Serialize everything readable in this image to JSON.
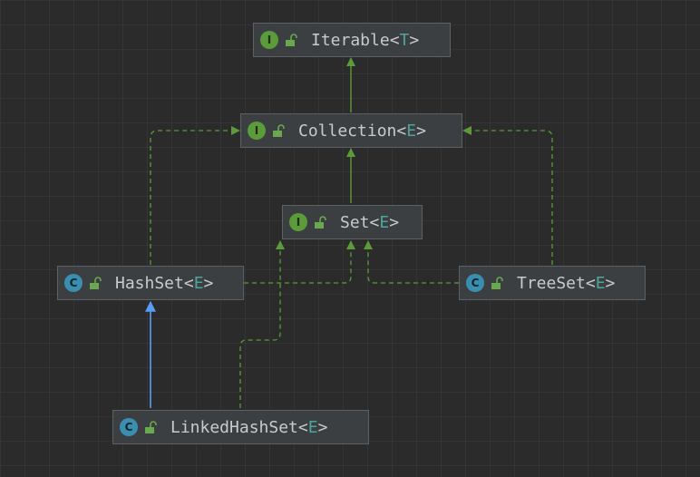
{
  "colors": {
    "background": "#2b2b2b",
    "node_fill": "#3c3f41",
    "node_border": "#5e6164",
    "text": "#c8cbce",
    "type_param": "#4fa59a",
    "implements_edge": "#5c9b3a",
    "extends_edge": "#589df6",
    "interface_badge": "#5c9b3a",
    "class_badge": "#3a8fb0"
  },
  "nodes": {
    "iterable": {
      "kind": "interface",
      "badge": "I",
      "name": "Iterable",
      "open": "<",
      "type_param": "T",
      "close": ">",
      "icon": "unlocked-padlock-icon"
    },
    "collection": {
      "kind": "interface",
      "badge": "I",
      "name": "Collection",
      "open": "<",
      "type_param": "E",
      "close": ">",
      "icon": "unlocked-padlock-icon"
    },
    "set": {
      "kind": "interface",
      "badge": "I",
      "name": "Set",
      "open": "<",
      "type_param": "E",
      "close": ">",
      "icon": "unlocked-padlock-icon"
    },
    "hashset": {
      "kind": "class",
      "badge": "C",
      "name": "HashSet",
      "open": "<",
      "type_param": "E",
      "close": ">",
      "icon": "unlocked-padlock-icon"
    },
    "treeset": {
      "kind": "class",
      "badge": "C",
      "name": "TreeSet",
      "open": "<",
      "type_param": "E",
      "close": ">",
      "icon": "unlocked-padlock-icon"
    },
    "linkedhashset": {
      "kind": "class",
      "badge": "C",
      "name": "LinkedHashSet",
      "open": "<",
      "type_param": "E",
      "close": ">",
      "icon": "unlocked-padlock-icon"
    }
  },
  "edges": [
    {
      "from": "collection",
      "to": "iterable",
      "relation": "extends",
      "style": "solid",
      "color": "#5c9b3a"
    },
    {
      "from": "set",
      "to": "collection",
      "relation": "extends",
      "style": "solid",
      "color": "#5c9b3a"
    },
    {
      "from": "hashset",
      "to": "collection",
      "relation": "implements",
      "style": "dashed",
      "color": "#5c9b3a"
    },
    {
      "from": "treeset",
      "to": "collection",
      "relation": "implements",
      "style": "dashed",
      "color": "#5c9b3a"
    },
    {
      "from": "hashset",
      "to": "set",
      "relation": "implements",
      "style": "dashed",
      "color": "#5c9b3a"
    },
    {
      "from": "treeset",
      "to": "set",
      "relation": "implements",
      "style": "dashed",
      "color": "#5c9b3a"
    },
    {
      "from": "linkedhashset",
      "to": "set",
      "relation": "implements",
      "style": "dashed",
      "color": "#5c9b3a"
    },
    {
      "from": "linkedhashset",
      "to": "hashset",
      "relation": "extends",
      "style": "solid",
      "color": "#589df6"
    }
  ]
}
